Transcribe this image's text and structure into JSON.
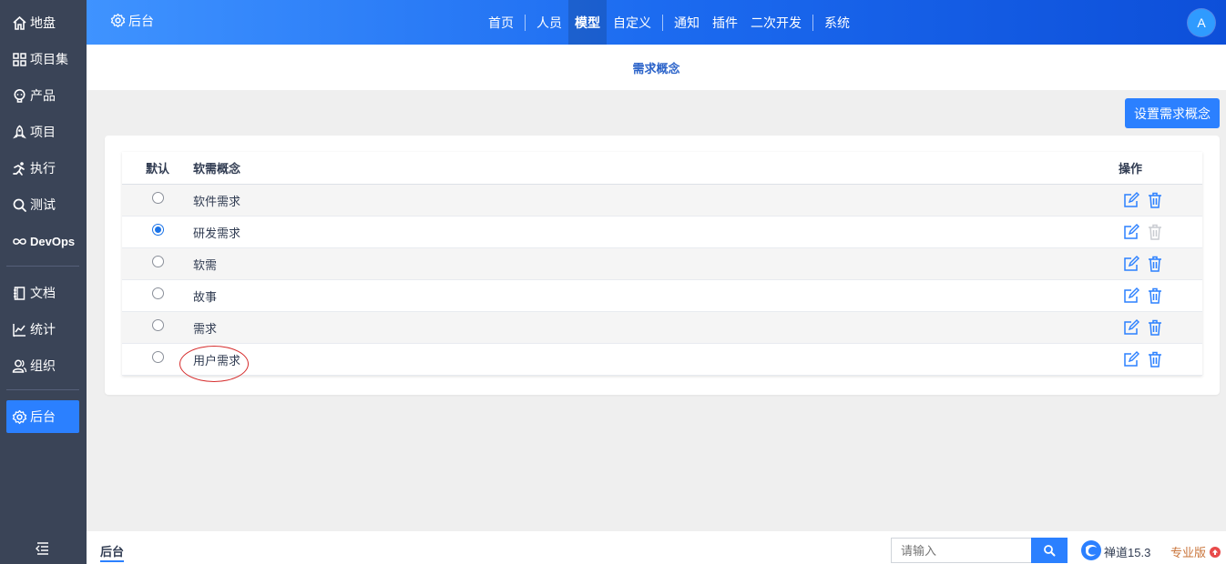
{
  "sidebar": {
    "items": [
      {
        "label": "地盘",
        "icon": "home-icon"
      },
      {
        "label": "项目集",
        "icon": "grid-icon"
      },
      {
        "label": "产品",
        "icon": "bulb-icon"
      },
      {
        "label": "项目",
        "icon": "rocket-icon"
      },
      {
        "label": "执行",
        "icon": "run-icon"
      },
      {
        "label": "测试",
        "icon": "magnifier-icon"
      },
      {
        "label": "DevOps",
        "icon": "infinity-icon"
      },
      {
        "label": "文档",
        "icon": "book-icon"
      },
      {
        "label": "统计",
        "icon": "chart-icon"
      },
      {
        "label": "组织",
        "icon": "people-icon"
      },
      {
        "label": "后台",
        "icon": "gear-icon",
        "active": true
      }
    ]
  },
  "header": {
    "brand": "后台",
    "nav": [
      "首页",
      "人员",
      "模型",
      "自定义",
      "通知",
      "插件",
      "二次开发",
      "系统"
    ],
    "active_nav": "模型",
    "avatar_initial": "A"
  },
  "subheader": {
    "title": "需求概念"
  },
  "actions": {
    "set_concept_label": "设置需求概念"
  },
  "table": {
    "columns": {
      "default": "默认",
      "name": "软需概念",
      "actions": "操作"
    },
    "rows": [
      {
        "name": "软件需求",
        "checked": false,
        "deletable": true
      },
      {
        "name": "研发需求",
        "checked": true,
        "deletable": false
      },
      {
        "name": "软需",
        "checked": false,
        "deletable": true
      },
      {
        "name": "故事",
        "checked": false,
        "deletable": true
      },
      {
        "name": "需求",
        "checked": false,
        "deletable": true
      },
      {
        "name": "用户需求",
        "checked": false,
        "deletable": true,
        "circled": true
      }
    ]
  },
  "footer": {
    "breadcrumb": "后台",
    "search_placeholder": "请输入",
    "version": "禅道15.3",
    "edition": "专业版"
  },
  "colors": {
    "accent": "#2b80ff",
    "sidebar_bg": "#3a4457",
    "annotation": "#d62d2d",
    "edition": "#c9743a"
  }
}
